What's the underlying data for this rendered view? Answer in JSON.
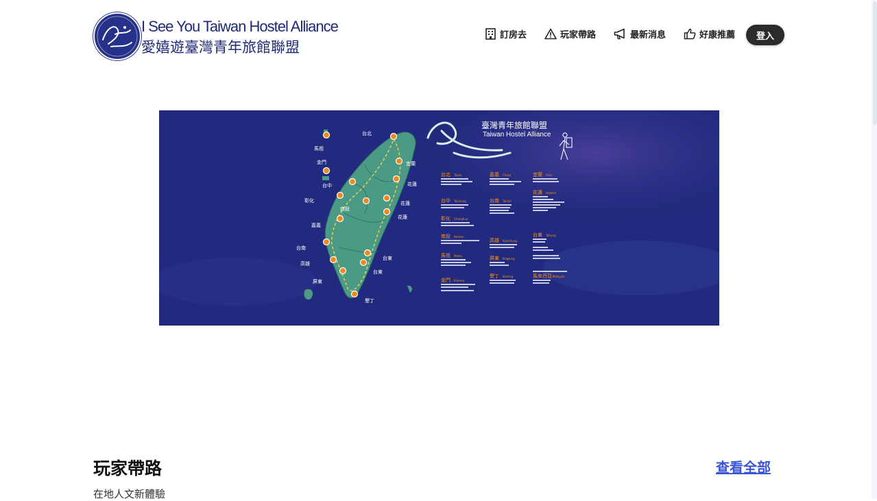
{
  "brand": {
    "name_en": "I See You Taiwan Hostel Alliance",
    "name_zh": "愛嬉遊臺灣青年旅館聯盟",
    "logo_icon": "alliance-logo-icon"
  },
  "nav": {
    "items": [
      {
        "label": "訂房去",
        "icon": "building-icon"
      },
      {
        "label": "玩家帶路",
        "icon": "warning-triangle-icon"
      },
      {
        "label": "最新消息",
        "icon": "megaphone-icon"
      },
      {
        "label": "好康推薦",
        "icon": "thumbs-up-icon"
      }
    ],
    "login_label": "登入"
  },
  "banner": {
    "title_zh": "臺灣青年旅館聯盟",
    "title_en": "Taiwan Hostel Alliance",
    "map_labels": [
      {
        "zh": "馬祖",
        "en": "Matsu"
      },
      {
        "zh": "台北",
        "en": "Taipei"
      },
      {
        "zh": "金門",
        "en": "Kinmen"
      },
      {
        "zh": "宜蘭",
        "en": "Yilan"
      },
      {
        "zh": "台中",
        "en": "Taichung"
      },
      {
        "zh": "花蓮",
        "en": "Hualien"
      },
      {
        "zh": "彰化",
        "en": "Changhua"
      },
      {
        "zh": "南投",
        "en": "Nantou"
      },
      {
        "zh": "花蓮",
        "en": "Hualien"
      },
      {
        "zh": "嘉義",
        "en": "Chiayi"
      },
      {
        "zh": "花蓮",
        "en": "Hualien"
      },
      {
        "zh": "台南",
        "en": "Tainan"
      },
      {
        "zh": "台東",
        "en": "Taitung"
      },
      {
        "zh": "高雄",
        "en": "Kaohsiung"
      },
      {
        "zh": "台東",
        "en": "Taitung"
      },
      {
        "zh": "屏東",
        "en": "Pingtung"
      },
      {
        "zh": "墾丁",
        "en": "Kenting"
      }
    ],
    "columns": [
      {
        "heads": [
          {
            "zh": "台北",
            "en": "Taipei"
          },
          {
            "zh": "台中",
            "en": "Taichung"
          },
          {
            "zh": "彰化",
            "en": "Changhua"
          },
          {
            "zh": "南投",
            "en": "Nantou"
          },
          {
            "zh": "馬祖",
            "en": "Matsu"
          },
          {
            "zh": "金門",
            "en": "Kinmen"
          }
        ]
      },
      {
        "heads": [
          {
            "zh": "嘉義",
            "en": "Chiayi"
          },
          {
            "zh": "台南",
            "en": "Tainan"
          },
          {
            "zh": "高雄",
            "en": "Kaohsiung"
          },
          {
            "zh": "屏東",
            "en": "Pingtung"
          },
          {
            "zh": "墾丁",
            "en": "Kenting"
          }
        ]
      },
      {
        "heads": [
          {
            "zh": "宜蘭",
            "en": "Yilan"
          },
          {
            "zh": "花蓮",
            "en": "Hualien"
          },
          {
            "zh": "台東",
            "en": "Taitung"
          },
          {
            "zh": "馬來西亞",
            "en": "Malaysia"
          }
        ]
      }
    ]
  },
  "section": {
    "title": "玩家帶路",
    "view_all": "查看全部",
    "subtitle": "在地人文新體驗"
  },
  "colors": {
    "brand_navy": "#1e2a78",
    "banner_bg": "#212a7e",
    "map_green": "#4a9a86",
    "pin_orange": "#f08a1c",
    "link_blue": "#3a55d6",
    "accent_orange": "#f7941d"
  }
}
